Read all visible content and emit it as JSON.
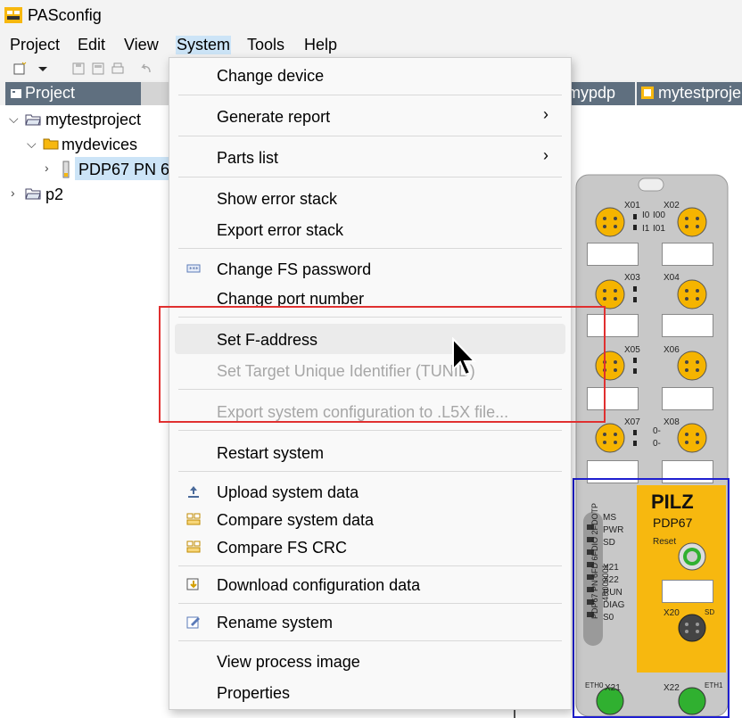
{
  "app": {
    "title": "PASconfig",
    "icon": "pasconfig-app-icon"
  },
  "menubar": {
    "items": [
      {
        "label": "Project"
      },
      {
        "label": "Edit"
      },
      {
        "label": "View"
      },
      {
        "label": "System"
      },
      {
        "label": "Tools"
      },
      {
        "label": "Help"
      }
    ],
    "active": "System"
  },
  "project_manager": {
    "tab_label": "Project manager",
    "tree": [
      {
        "label": "mytestproject",
        "expanded": true,
        "icon": "open-folder-icon"
      },
      {
        "label": "mydevices",
        "expanded": true,
        "icon": "device-folder-icon"
      },
      {
        "label": "PDP67 PN 6F",
        "expanded": false,
        "icon": "device-module-icon",
        "selected": true
      },
      {
        "label": "p2",
        "expanded": false,
        "icon": "open-folder-icon"
      }
    ]
  },
  "editor_tabs": [
    {
      "label": "mypdp"
    },
    {
      "label": "mytestproje"
    }
  ],
  "context_menu": {
    "items": [
      {
        "label": "Change device",
        "enabled": true
      },
      {
        "label": "Generate report",
        "enabled": true,
        "submenu": true
      },
      {
        "label": "Parts list",
        "enabled": true,
        "submenu": true
      },
      {
        "label": "Show error stack",
        "enabled": true
      },
      {
        "label": "Export error stack",
        "enabled": true
      },
      {
        "label": "Change FS password",
        "enabled": true,
        "icon": "password-icon"
      },
      {
        "label": "Change port number",
        "enabled": true
      },
      {
        "label": "Set F-address",
        "enabled": true,
        "hovered": true
      },
      {
        "label": "Set Target Unique Identifier (TUNID)",
        "enabled": false
      },
      {
        "label": "Export system configuration to .L5X file...",
        "enabled": false
      },
      {
        "label": "Restart system",
        "enabled": true
      },
      {
        "label": "Upload system data",
        "enabled": true,
        "icon": "upload-icon"
      },
      {
        "label": "Compare system data",
        "enabled": true,
        "icon": "compare-icon"
      },
      {
        "label": "Compare FS CRC",
        "enabled": true,
        "icon": "compare-icon"
      },
      {
        "label": "Download configuration data",
        "enabled": true,
        "icon": "download-icon"
      },
      {
        "label": "Rename system",
        "enabled": true,
        "icon": "rename-icon"
      },
      {
        "label": "View process image",
        "enabled": true
      },
      {
        "label": "Properties",
        "enabled": true
      }
    ],
    "submenu_glyph": "›"
  },
  "device": {
    "brand": "PILZ",
    "model": "PDP67",
    "reset_label": "Reset",
    "port_labels": [
      "X01",
      "X02",
      "X03",
      "X04",
      "X05",
      "X06",
      "X07",
      "X08",
      "X20",
      "X21",
      "X22"
    ],
    "io_labels": [
      "I0",
      "I1",
      "I00",
      "I01",
      "0-",
      "0-"
    ],
    "status_leds": [
      "MS",
      "PWR",
      "SD",
      "X21",
      "X22",
      "RUN",
      "DIAG",
      "S0"
    ],
    "vertical_text": "PDP67 PN 6FD 6FDIO 2FDOTP",
    "serial_text": "4R000001",
    "eth_labels": [
      "ETH0",
      "ETH1"
    ],
    "sd_label": "SD",
    "colors": {
      "brand_yellow": "#f7b80f",
      "housing_gray": "#c8c8c8",
      "port_yellow": "#f5b400",
      "port_green": "#30b030"
    }
  },
  "annotations": {
    "red_box_color": "#e03030",
    "blue_box_color": "#1f1fd0"
  }
}
